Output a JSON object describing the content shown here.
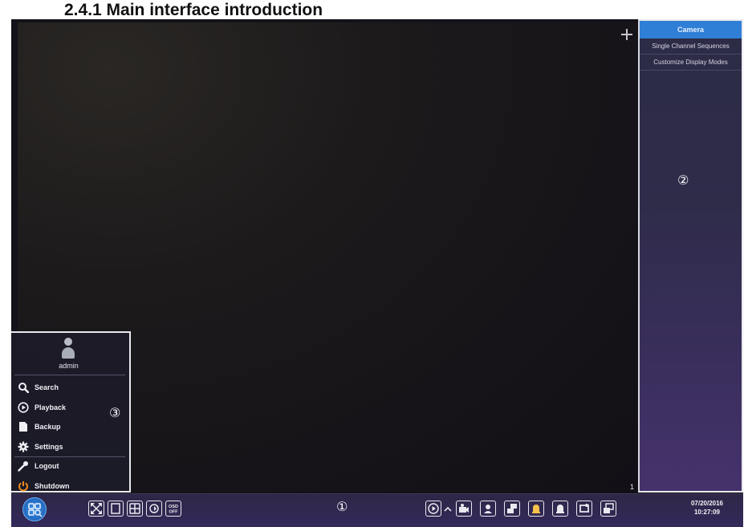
{
  "document": {
    "heading": "2.4.1 Main interface introduction"
  },
  "live_view": {
    "channel_number": "1",
    "add_icon": "plus-icon"
  },
  "right_panel": {
    "header": "Camera",
    "items": [
      {
        "label": "Single Channel Sequences"
      },
      {
        "label": "Customize Display Modes"
      }
    ],
    "callout": "②"
  },
  "start_menu": {
    "username": "admin",
    "avatar_icon": "user-avatar-icon",
    "items": [
      {
        "label": "Search",
        "icon": "search-icon"
      },
      {
        "label": "Playback",
        "icon": "play-circle-icon"
      },
      {
        "label": "Backup",
        "icon": "document-icon"
      },
      {
        "label": "Settings",
        "icon": "gear-icon"
      },
      {
        "label": "Logout",
        "icon": "key-icon"
      },
      {
        "label": "Shutdown",
        "icon": "power-icon"
      }
    ],
    "callout": "③"
  },
  "taskbar": {
    "callout": "①",
    "date": "07/20/2016",
    "time": "10:27:09",
    "left_tools": [
      {
        "icon": "fullscreen-icon"
      },
      {
        "icon": "single-layout-icon"
      },
      {
        "icon": "quad-layout-icon"
      },
      {
        "icon": "sequence-icon"
      },
      {
        "icon": "osd-off-icon",
        "label": "OSD OFF"
      }
    ],
    "right_tools": [
      {
        "icon": "playback-icon"
      },
      {
        "icon": "chevron-up-icon"
      },
      {
        "icon": "camera-icon"
      },
      {
        "icon": "person-icon"
      },
      {
        "icon": "record-icon"
      },
      {
        "icon": "alarm-bell-icon"
      },
      {
        "icon": "bell-icon"
      },
      {
        "icon": "snapshot-icon"
      },
      {
        "icon": "windows-icon"
      }
    ],
    "colors": {
      "accent": "#2f7fd6",
      "alarm": "#f5c14a"
    }
  }
}
